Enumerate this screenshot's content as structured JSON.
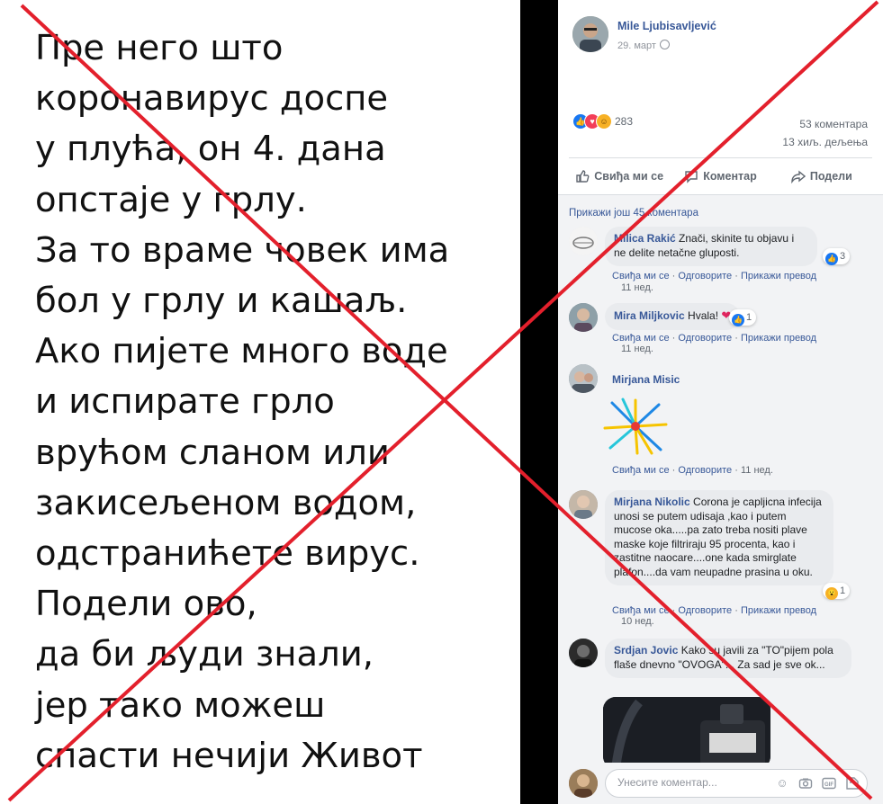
{
  "post_text_lines": [
    "Пре него што",
    "коронавирус доспе",
    "у плућа, он 4. дана",
    "опстаје у грлу.",
    "За то враме човек има",
    "бол у грлу и кашаљ.",
    "Ако пијете много воде",
    "и испирате грло",
    "врућом сланом или",
    "закисељеном водом,",
    "одстранићете вирус.",
    "Подели ово,",
    "да би људи знали,",
    "јер тако можеш",
    "спасти нечији Живот"
  ],
  "post": {
    "author": "Mile Ljubisavljević",
    "date": "29. март",
    "reaction_count": "283",
    "comments_count": "53 коментара",
    "shares_count": "13 хиљ. дељења",
    "reactions": [
      "like",
      "love",
      "haha"
    ]
  },
  "actions": {
    "like": "Свиђа ми се",
    "comment": "Коментар",
    "share": "Подели"
  },
  "more_comments": "Прикажи још 45 коментара",
  "link_labels": {
    "like": "Свиђа ми се",
    "reply": "Одговорите",
    "translate": "Прикажи превод",
    "sep": "·"
  },
  "comments": [
    {
      "name": "Milica Rakić",
      "text": "Znači, skinite tu objavu i ne delite netačne gluposti.",
      "reaction_count": "3",
      "time": "11 нед."
    },
    {
      "name": "Mira Miljkovic",
      "text": "Hvala!",
      "reaction_count": "1",
      "time": "11 нед."
    },
    {
      "name": "Mirjana Misic",
      "text": "",
      "time": "11 нед."
    },
    {
      "name": "Mirjana Nikolic",
      "text": "Corona je capljicna infecija unosi se putem udisaja ,kao i putem mucose oka.....pa zato treba nositi plave maske koje filtriraju 95 procenta, kao i zastitne naocare....one kada smirglate plafon....da vam neupadne prasina u oku.",
      "reaction_count": "1",
      "time": "10 нед."
    },
    {
      "name": "Srdjan Jovic",
      "text": "Kako su javili za \"TO\"pijem pola flaše dnevno \"OVOGA\"... Za sad je sve ok...",
      "time": ""
    }
  ],
  "compose": {
    "placeholder": "Унесите коментар..."
  },
  "colors": {
    "link_blue": "#385898",
    "fb_blue": "#1877f2",
    "red_x": "#e3202c",
    "comment_bg": "#f2f3f5"
  }
}
